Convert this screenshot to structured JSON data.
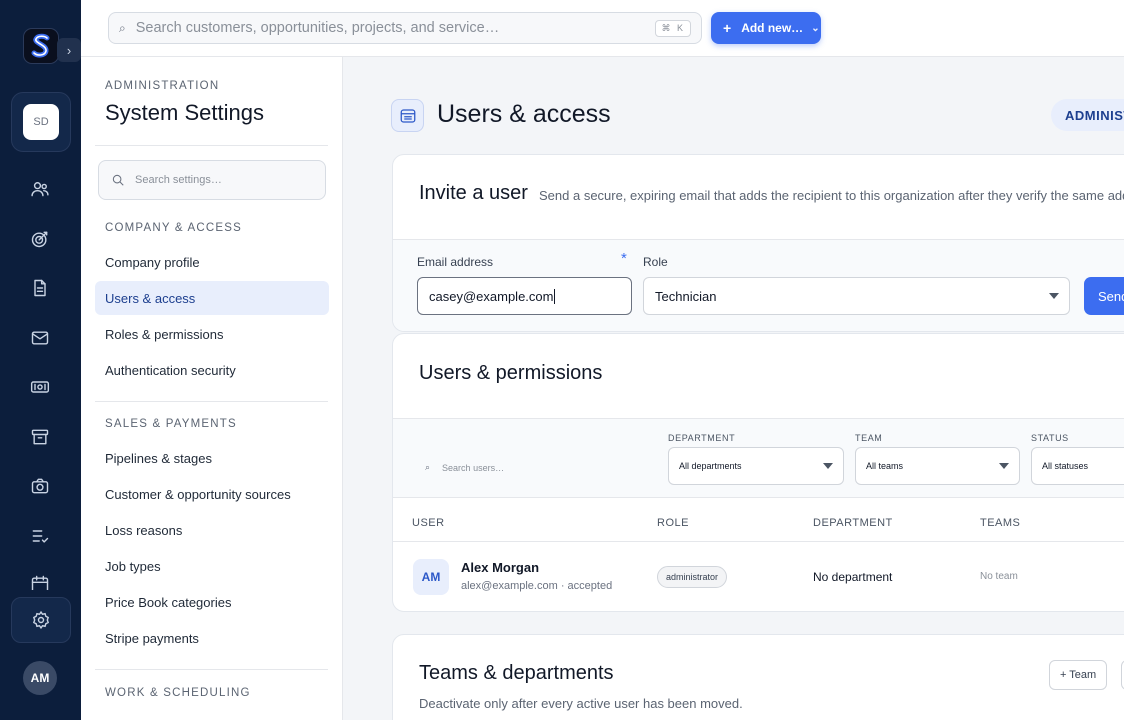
{
  "rail": {
    "org_initials": "SD",
    "user_initials": "AM",
    "icons": [
      "users-icon",
      "target-icon",
      "document-icon",
      "mail-icon",
      "money-icon",
      "archive-icon",
      "camera-icon",
      "checklist-icon",
      "calendar-icon",
      "gear-icon"
    ]
  },
  "topbar": {
    "search_placeholder": "Search customers, opportunities, projects, and service…",
    "shortcut": "⌘ K",
    "add_new_label": "Add new…"
  },
  "settings_nav": {
    "kicker": "ADMINISTRATION",
    "title": "System Settings",
    "search_placeholder": "Search settings…",
    "sections": [
      {
        "heading": "COMPANY & ACCESS",
        "items": [
          "Company profile",
          "Users & access",
          "Roles & permissions",
          "Authentication security"
        ]
      },
      {
        "heading": "SALES & PAYMENTS",
        "items": [
          "Pipelines & stages",
          "Customer & opportunity sources",
          "Loss reasons",
          "Job types",
          "Price Book categories",
          "Stripe payments"
        ]
      },
      {
        "heading": "WORK & SCHEDULING",
        "items": []
      }
    ],
    "active_item": "Users & access"
  },
  "main": {
    "page_title": "Users & access",
    "role_badge": "ADMINISTRATOR",
    "invite": {
      "title": "Invite a user",
      "description": "Send a secure, expiring email that adds the recipient to this organization after they verify the same address.",
      "email_label": "Email address",
      "email_value": "casey@example.com",
      "required_mark": "*",
      "role_label": "Role",
      "role_value": "Technician",
      "send_label": "Send invite"
    },
    "users": {
      "title": "Users & permissions",
      "search_placeholder": "Search users…",
      "filters": [
        {
          "label": "DEPARTMENT",
          "value": "All departments"
        },
        {
          "label": "TEAM",
          "value": "All teams"
        },
        {
          "label": "STATUS",
          "value": "All statuses"
        }
      ],
      "columns": [
        "USER",
        "ROLE",
        "DEPARTMENT",
        "TEAMS"
      ],
      "rows": [
        {
          "initials": "AM",
          "name": "Alex Morgan",
          "sub": "alex@example.com · accepted",
          "role": "administrator",
          "department": "No department",
          "teams": "No team"
        }
      ]
    },
    "teams": {
      "title": "Teams & departments",
      "description": "Deactivate only after every active user has been moved.",
      "add_team_label": "+ Team"
    }
  },
  "colors": {
    "rail_bg": "#0c1e3c",
    "accent": "#3c6df0",
    "active_nav_bg": "#e8eefc"
  }
}
